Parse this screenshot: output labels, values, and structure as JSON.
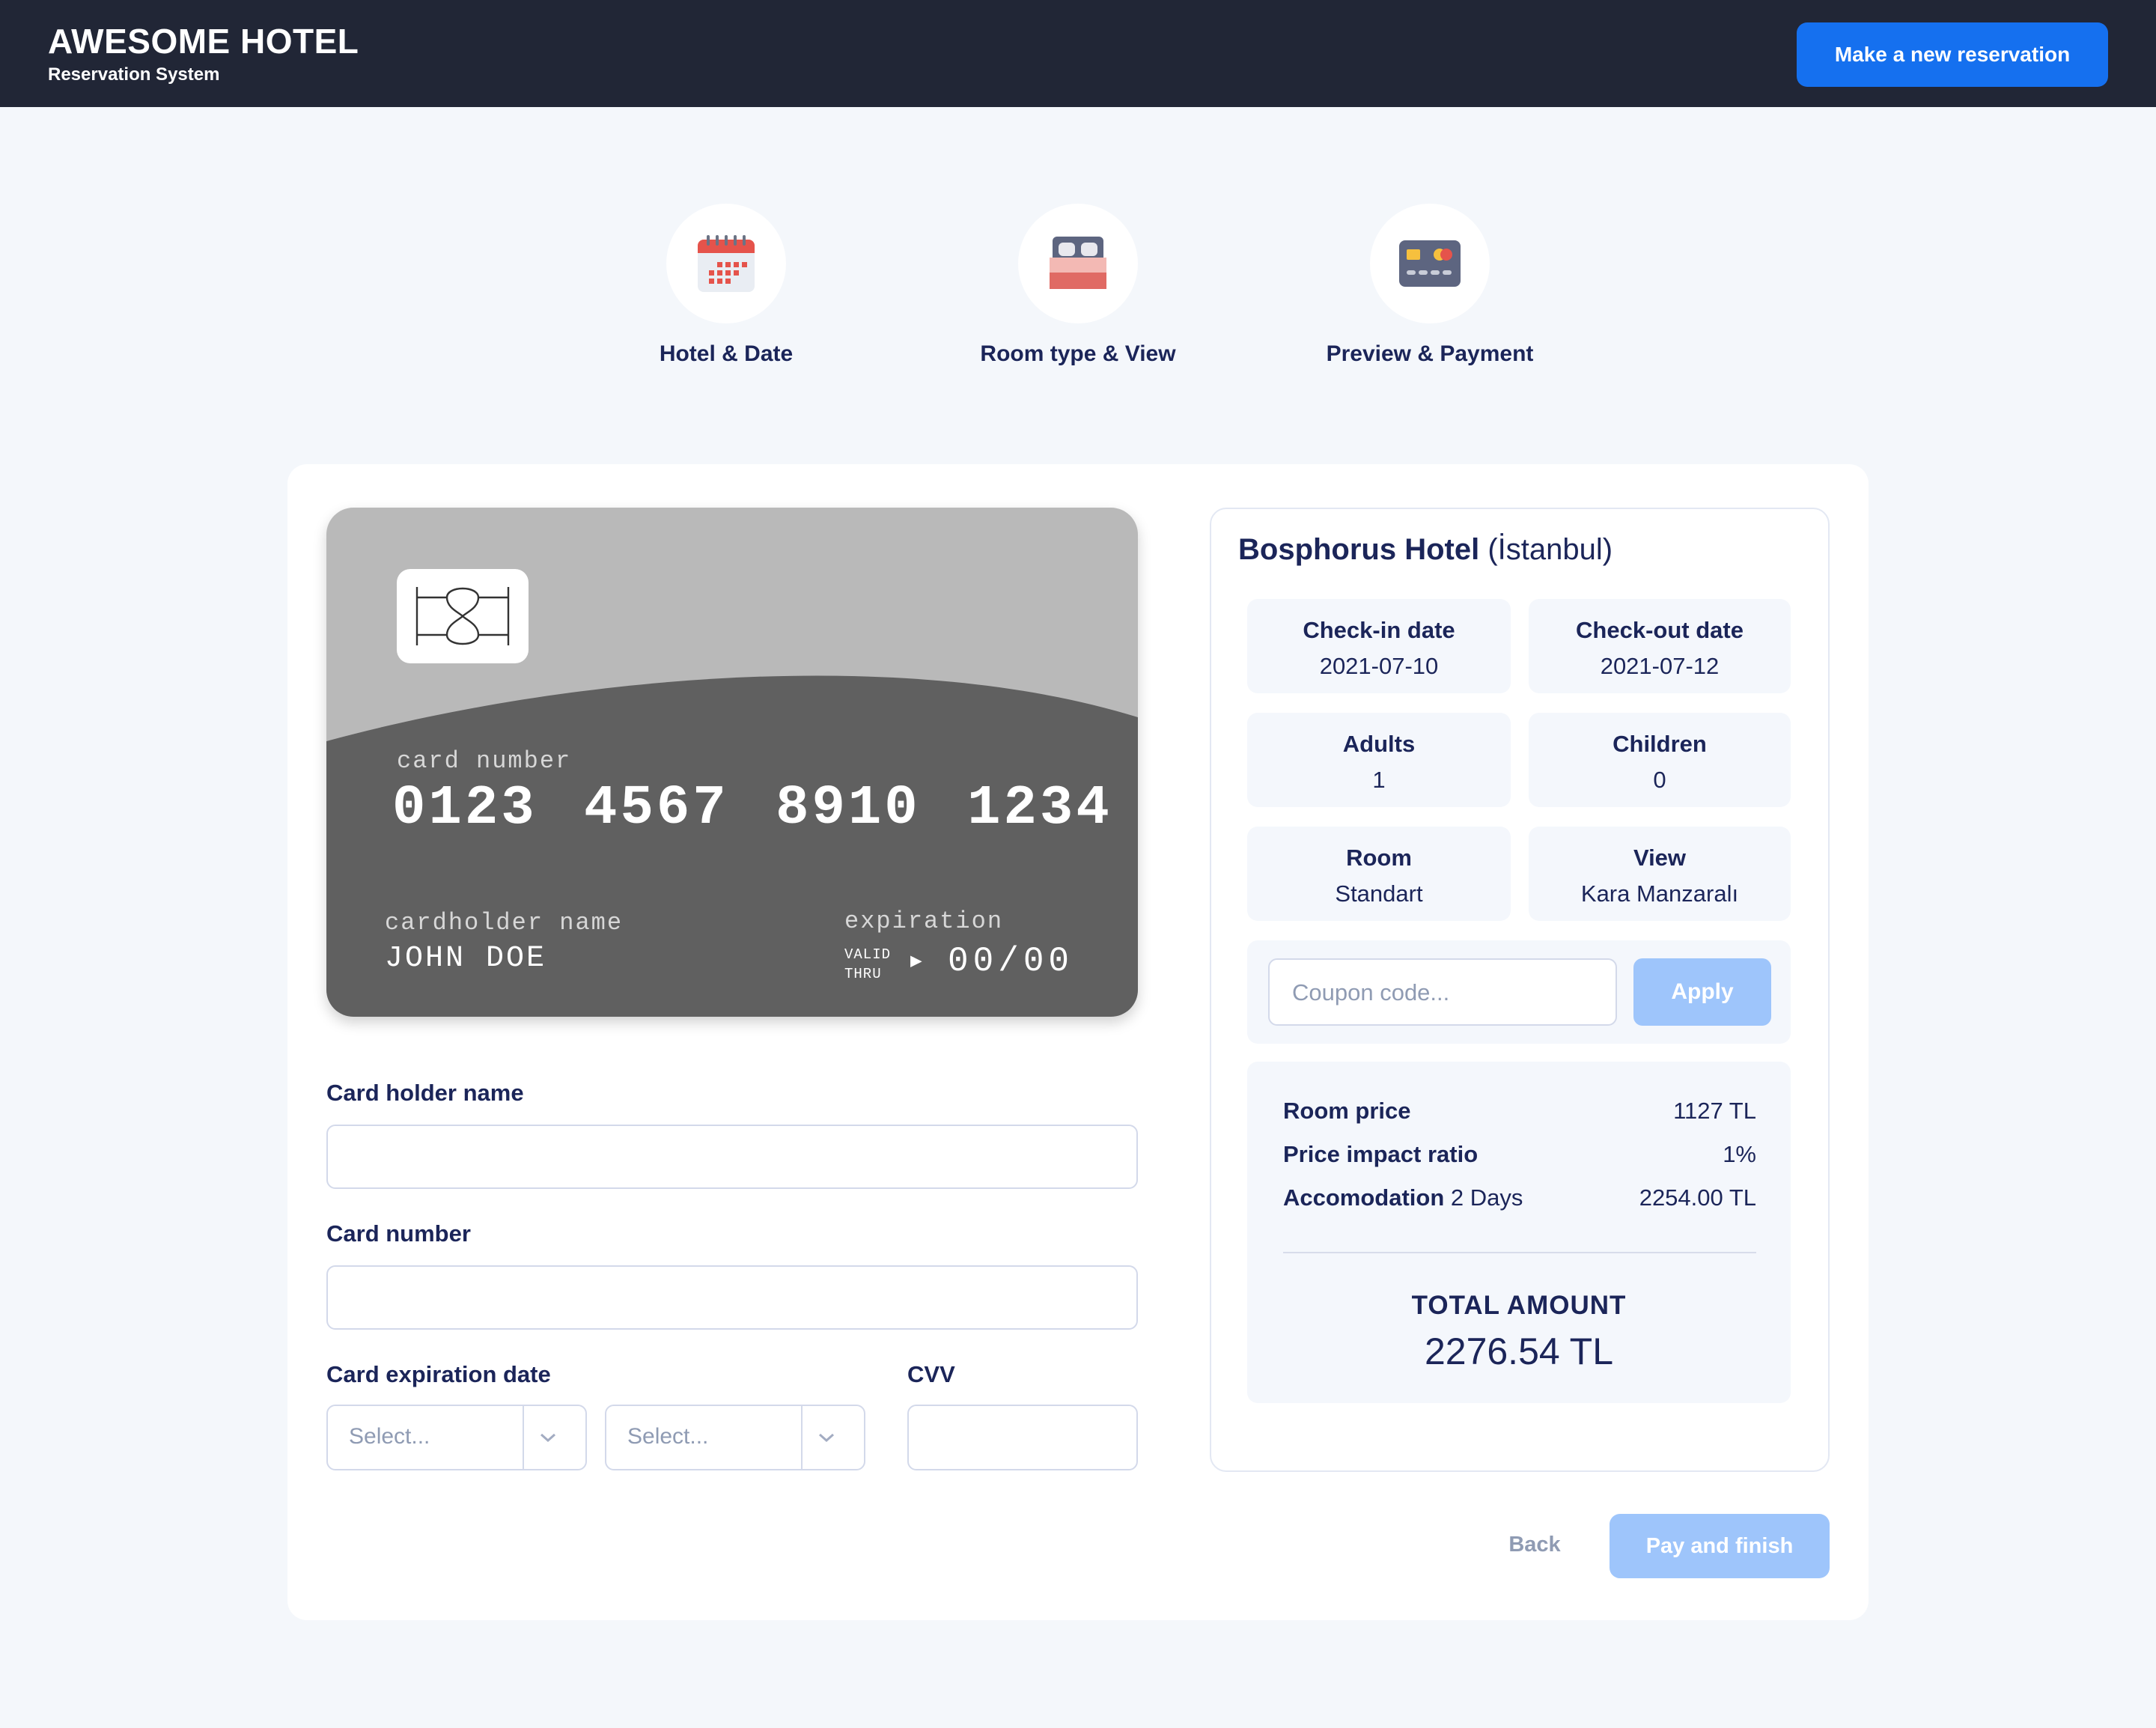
{
  "header": {
    "title": "AWESOME HOTEL",
    "subtitle": "Reservation System",
    "new_reservation_label": "Make a new reservation"
  },
  "steps": [
    {
      "label": "Hotel & Date",
      "icon": "calendar-icon"
    },
    {
      "label": "Room type & View",
      "icon": "bed-icon"
    },
    {
      "label": "Preview & Payment",
      "icon": "credit-card-icon"
    }
  ],
  "card_preview": {
    "number_label": "card number",
    "number": "0123 4567 8910 1234",
    "holder_label": "cardholder name",
    "holder": "JOHN DOE",
    "expiration_label": "expiration",
    "valid_thru": "VALID THRU",
    "expiration": "00/00"
  },
  "form": {
    "holder_name_label": "Card holder name",
    "card_number_label": "Card number",
    "expiration_label": "Card expiration date",
    "month_placeholder": "Select...",
    "year_placeholder": "Select...",
    "cvv_label": "CVV"
  },
  "summary": {
    "hotel_name": "Bosphorus Hotel",
    "hotel_city": "(İstanbul)",
    "info": [
      {
        "label": "Check-in date",
        "value": "2021-07-10"
      },
      {
        "label": "Check-out date",
        "value": "2021-07-12"
      },
      {
        "label": "Adults",
        "value": "1"
      },
      {
        "label": "Children",
        "value": "0"
      },
      {
        "label": "Room",
        "value": "Standart"
      },
      {
        "label": "View",
        "value": "Kara Manzaralı"
      }
    ],
    "coupon_placeholder": "Coupon code...",
    "apply_label": "Apply",
    "prices": [
      {
        "label": "Room price",
        "extra": "",
        "value": "1127 TL"
      },
      {
        "label": "Price impact ratio",
        "extra": "",
        "value": "1%"
      },
      {
        "label": "Accomodation",
        "extra": "2 Days",
        "value": "2254.00 TL"
      }
    ],
    "total_label": "TOTAL AMOUNT",
    "total_value": "2276.54 TL"
  },
  "actions": {
    "back_label": "Back",
    "pay_label": "Pay and finish"
  },
  "colors": {
    "header_bg": "#212636",
    "accent": "#1570ef",
    "disabled_accent": "#9ec5fb",
    "text": "#1b2559",
    "page_bg": "#f4f7fb"
  }
}
